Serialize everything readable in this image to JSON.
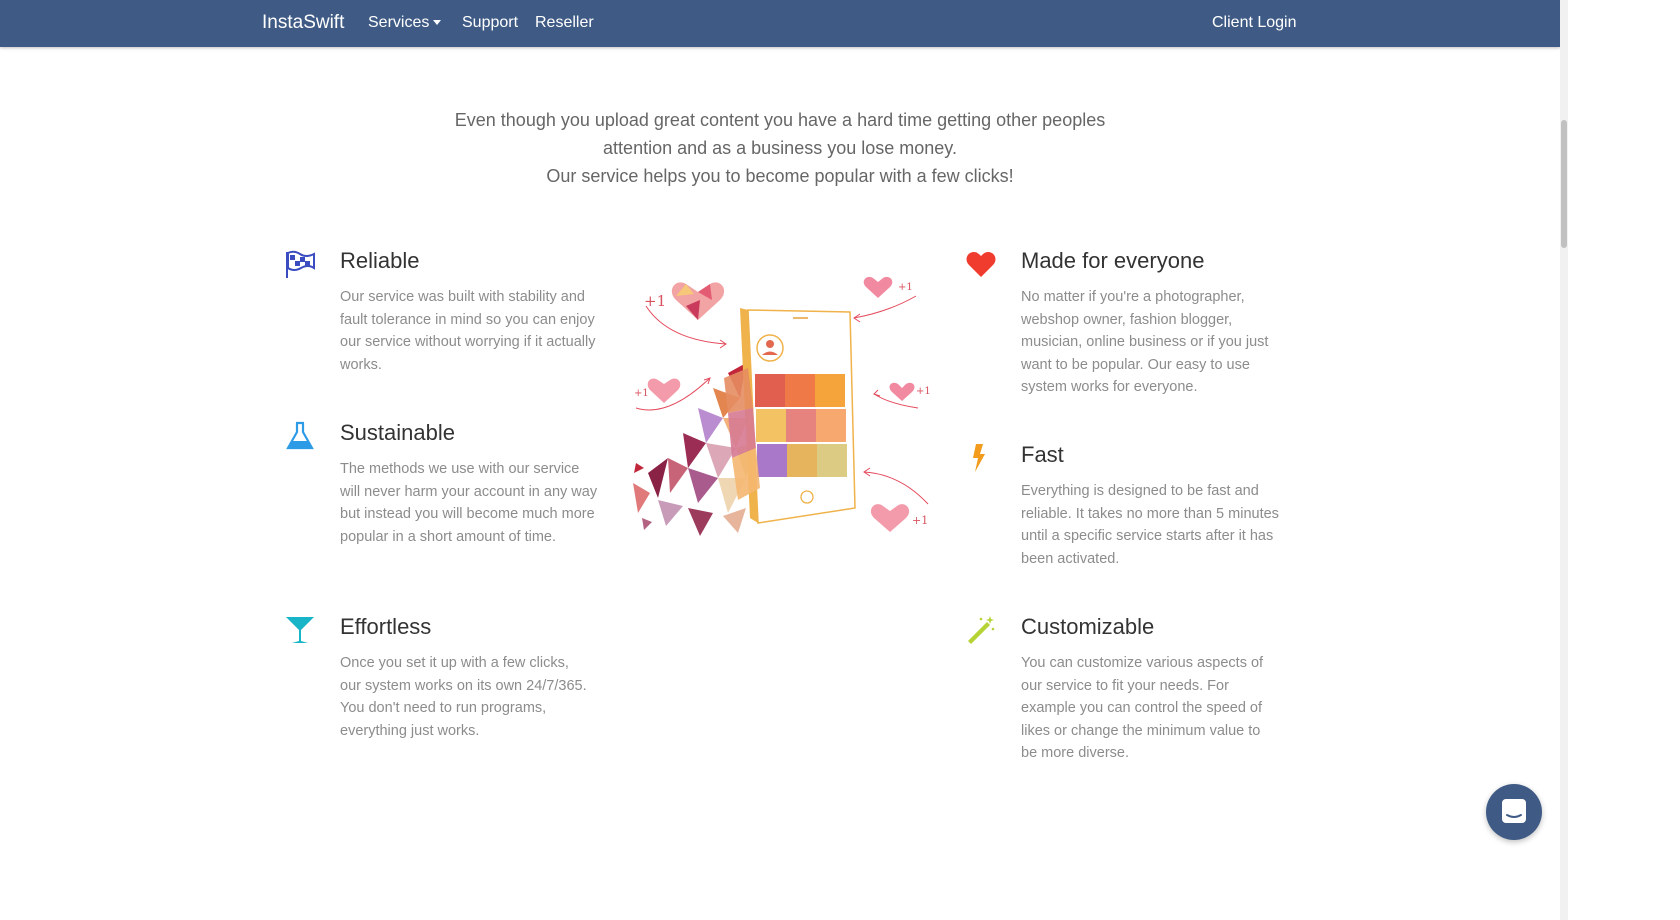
{
  "nav": {
    "brand": "InstaSwift",
    "items": [
      "Services",
      "Support",
      "Reseller"
    ],
    "login": "Client Login"
  },
  "intro": {
    "line1": "Even though you upload great content you have a hard time getting other peoples",
    "line2": "attention and as a business you lose money.",
    "line3": "Our service helps you to become popular with a few clicks!"
  },
  "features_left": [
    {
      "title": "Reliable",
      "text": "Our service was built with stability and fault tolerance in mind so you can enjoy our service without worrying if it actually works.",
      "icon": "flag-icon",
      "color": "#3b4cc0"
    },
    {
      "title": "Sustainable",
      "text": "The methods we use with our service will never harm your account in any way but instead you will become much more popular in a short amount of time.",
      "icon": "flask-icon",
      "color": "#2e9be6"
    },
    {
      "title": "Effortless",
      "text": "Once you set it up with a few clicks, our system works on its own 24/7/365. You don't need to run programs, everything just works.",
      "icon": "cocktail-icon",
      "color": "#18b5c9"
    }
  ],
  "features_right": [
    {
      "title": "Made for everyone",
      "text": "No matter if you're a photographer, webshop owner, fashion blogger, musician, online business or if you just want to be popular. Our easy to use system works for everyone.",
      "icon": "heart-icon",
      "color": "#f03c2e"
    },
    {
      "title": "Fast",
      "text": "Everything is designed to be fast and reliable. It takes no more than 5 minutes until a specific service starts after it has been activated.",
      "icon": "bolt-icon",
      "color": "#f29b1c"
    },
    {
      "title": "Customizable",
      "text": "You can customize various aspects of our service to fit your needs. For example you can control the speed of likes or change the minimum value to be more diverse.",
      "icon": "magic-wand-icon",
      "color": "#b5d334"
    }
  ],
  "illustration": {
    "labels": [
      "+1",
      "+1",
      "+1",
      "+1",
      "+1"
    ]
  },
  "colors": {
    "navbar": "#3f5b85",
    "chat": "#3f5b85"
  }
}
